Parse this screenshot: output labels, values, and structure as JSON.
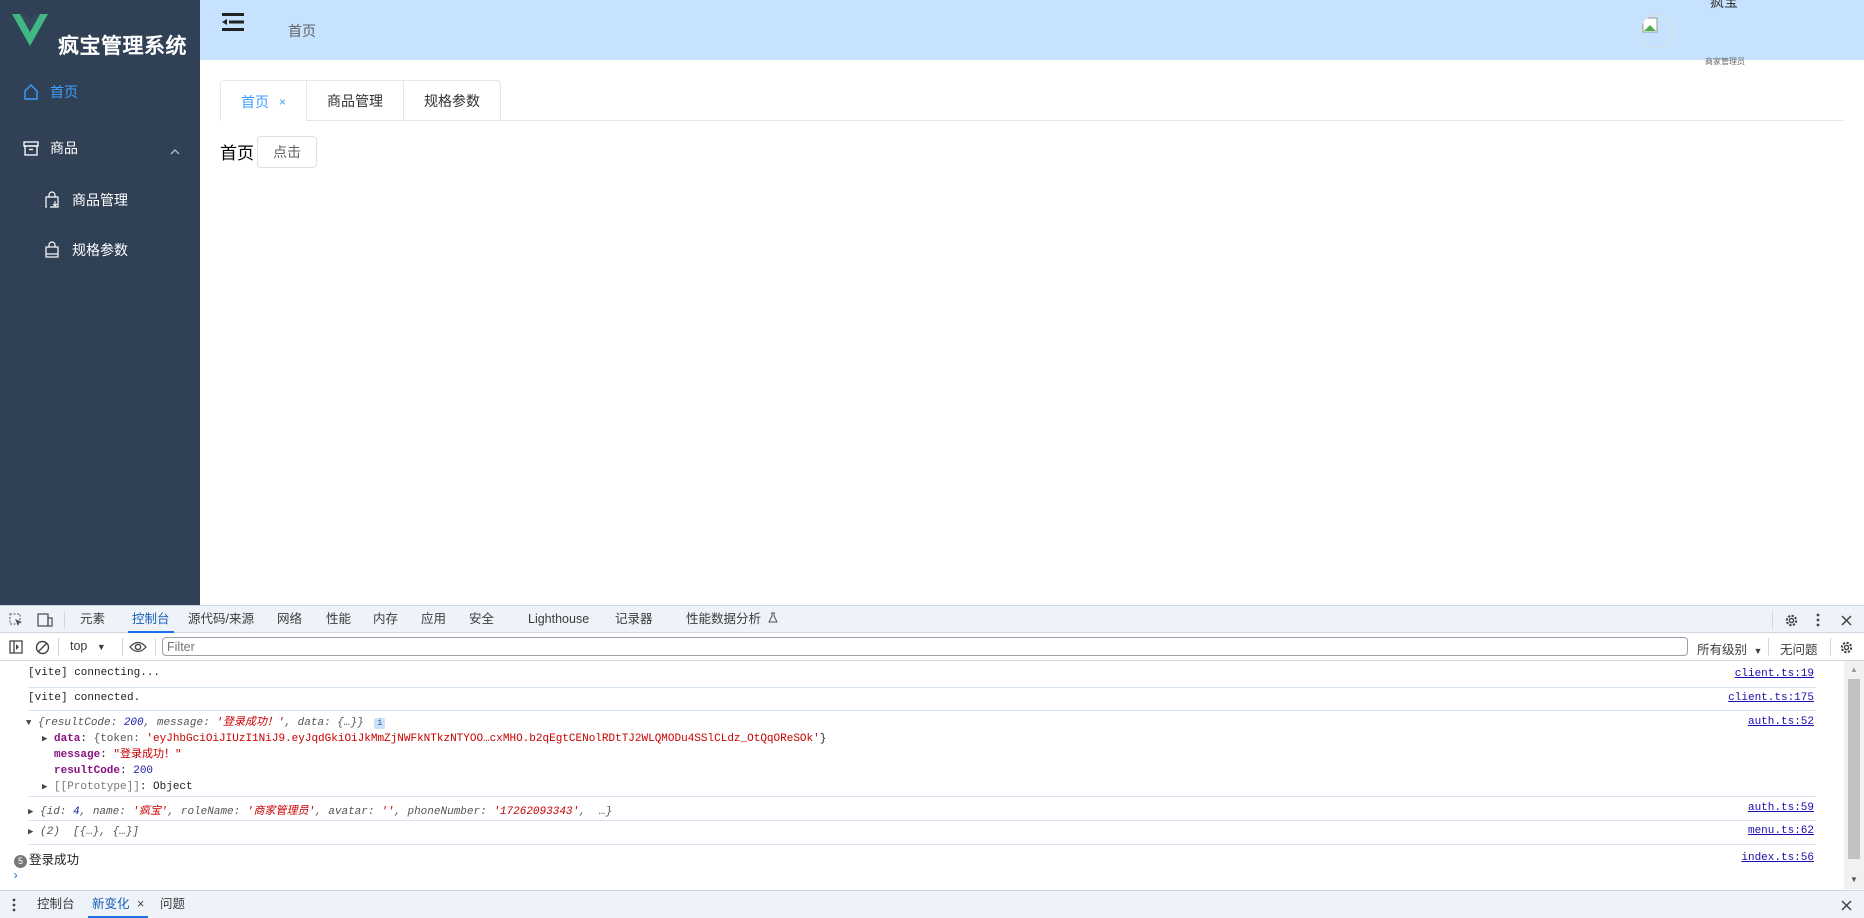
{
  "app": {
    "title": "疯宝管理系统",
    "brand_color": "#41b883",
    "sidebar": {
      "items": [
        {
          "label": "首页",
          "icon": "home-icon",
          "active": true
        },
        {
          "label": "商品",
          "icon": "box-icon",
          "expanded": true
        },
        {
          "label": "商品管理",
          "icon": "shopping-bag-icon"
        },
        {
          "label": "规格参数",
          "icon": "bag-icon"
        }
      ]
    },
    "header": {
      "breadcrumb": "首页",
      "user_name": "疯宝",
      "user_role": "商家管理员"
    },
    "tabs": [
      {
        "label": "首页",
        "active": true,
        "closable": true,
        "close": "×"
      },
      {
        "label": "商品管理"
      },
      {
        "label": "规格参数"
      }
    ],
    "page": {
      "title": "首页",
      "button_label": "点击"
    }
  },
  "devtools": {
    "tabs": [
      "元素",
      "控制台",
      "源代码/来源",
      "网络",
      "性能",
      "内存",
      "应用",
      "安全",
      "Lighthouse",
      "记录器",
      "性能数据分析"
    ],
    "active_tab": "控制台",
    "context": "top",
    "filter_placeholder": "Filter",
    "levels": "所有级别",
    "issues": "无问题",
    "console": {
      "lines": [
        {
          "text": "[vite] connecting...",
          "source": "client.ts:19"
        },
        {
          "text": "[vite] connected.",
          "source": "client.ts:175"
        },
        {
          "source": "auth.ts:52",
          "header": {
            "k1": "resultCode",
            "v1": "200",
            "k2": "message",
            "v2": "'登录成功！'",
            "k3": "data",
            "v3": "{…}}"
          },
          "data_key": "data",
          "data_token_key": "{token: ",
          "data_token": "'eyJhbGciOiJIUzI1NiJ9.eyJqdGkiOiJkMmZjNWFkNTkzNTYOO…cxMHO.b2qEgtCENolRDtTJ2WLQMODu4SSlCLdz_OtQqOReSOk'",
          "message_key": "message",
          "message_val": "\"登录成功！\"",
          "result_key": "resultCode",
          "result_val": "200",
          "proto": "[[Prototype]]",
          "proto_val": "Object"
        },
        {
          "source": "auth.ts:59",
          "pre": "{id: ",
          "id": "4",
          "name_k": ", name: ",
          "name_v": "'疯宝'",
          "role_k": ", roleName: ",
          "role_v": "'商家管理员'",
          "av_k": ", avatar: ",
          "av_v": "''",
          "ph_k": ", phoneNumber: ",
          "ph_v": "'17262093343'",
          "tail": ",  …}"
        },
        {
          "text": "(2)  [{…}, {…}]",
          "source": "menu.ts:62"
        },
        {
          "count": "5",
          "text": "登录成功",
          "source": "index.ts:56"
        }
      ]
    },
    "drawer": {
      "tabs": [
        "控制台",
        "新变化",
        "问题"
      ],
      "active": "新变化",
      "close": "×"
    }
  }
}
